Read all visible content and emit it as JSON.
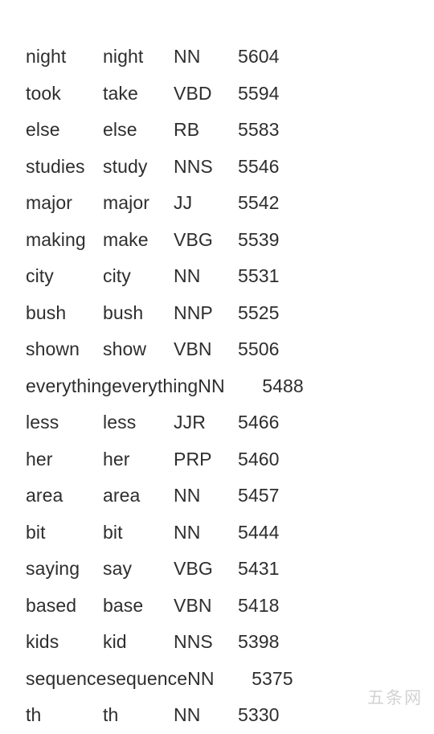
{
  "document": {
    "type": "word-frequency-list",
    "columns": [
      "word",
      "lemma",
      "pos_tag",
      "count"
    ],
    "text_color": "#2e2e2e",
    "background_color": "#ffffff",
    "rows": [
      {
        "word": "night",
        "lemma": "night",
        "pos_tag": "NN",
        "count": "5604"
      },
      {
        "word": "took",
        "lemma": "take",
        "pos_tag": "VBD",
        "count": "5594"
      },
      {
        "word": "else",
        "lemma": "else",
        "pos_tag": "RB",
        "count": "5583"
      },
      {
        "word": "studies",
        "lemma": "study",
        "pos_tag": "NNS",
        "count": "5546"
      },
      {
        "word": "major",
        "lemma": "major",
        "pos_tag": "JJ",
        "count": "5542"
      },
      {
        "word": "making",
        "lemma": "make",
        "pos_tag": "VBG",
        "count": "5539"
      },
      {
        "word": "city",
        "lemma": "city",
        "pos_tag": "NN",
        "count": "5531"
      },
      {
        "word": "bush",
        "lemma": "bush",
        "pos_tag": "NNP",
        "count": "5525"
      },
      {
        "word": "shown",
        "lemma": "show",
        "pos_tag": "VBN",
        "count": "5506"
      },
      {
        "word": "everything",
        "lemma": "everything",
        "pos_tag": "NN",
        "count": "5488"
      },
      {
        "word": "less",
        "lemma": "less",
        "pos_tag": "JJR",
        "count": "5466"
      },
      {
        "word": "her",
        "lemma": "her",
        "pos_tag": "PRP",
        "count": "5460"
      },
      {
        "word": "area",
        "lemma": "area",
        "pos_tag": "NN",
        "count": "5457"
      },
      {
        "word": "bit",
        "lemma": "bit",
        "pos_tag": "NN",
        "count": "5444"
      },
      {
        "word": "saying",
        "lemma": "say",
        "pos_tag": "VBG",
        "count": "5431"
      },
      {
        "word": "based",
        "lemma": "base",
        "pos_tag": "VBN",
        "count": "5418"
      },
      {
        "word": "kids",
        "lemma": "kid",
        "pos_tag": "NNS",
        "count": "5398"
      },
      {
        "word": "sequence",
        "lemma": "sequence",
        "pos_tag": "NN",
        "count": "5375"
      },
      {
        "word": "th",
        "lemma": "th",
        "pos_tag": "NN",
        "count": "5330"
      }
    ]
  },
  "watermark": {
    "text": "五条网",
    "color": "#d2d2d2"
  }
}
